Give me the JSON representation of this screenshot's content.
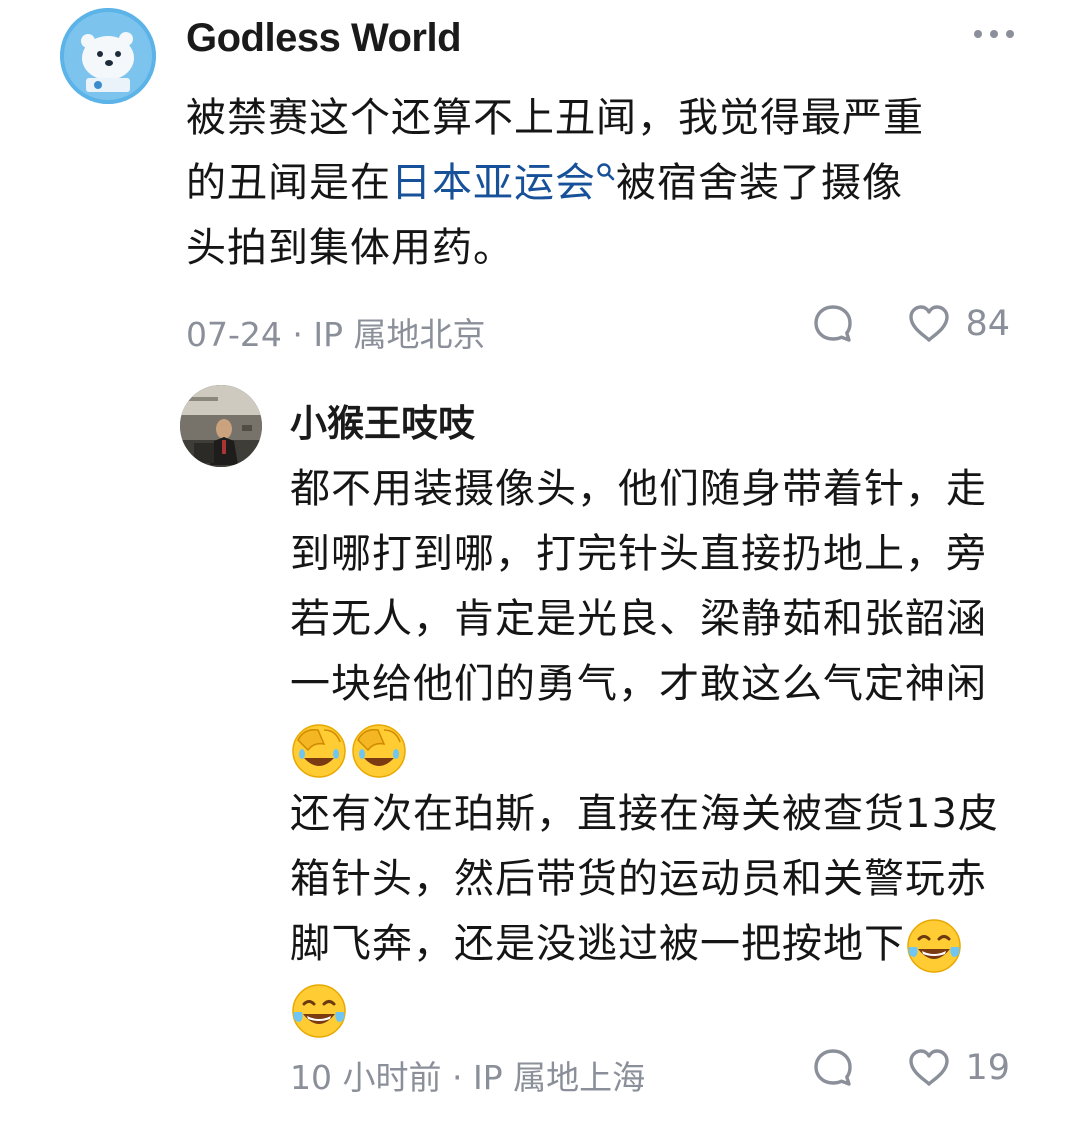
{
  "comments": [
    {
      "author": "Godless World",
      "avatar_icon": "polar-bear-avatar",
      "text_lines": [
        {
          "pre": "被禁赛这个还算不上丑闻，我觉得最严重"
        },
        {
          "pre": "的丑闻是在",
          "link": "日本亚运会",
          "post": "被宿舍装了摄像"
        },
        {
          "pre": "头拍到集体用药。"
        }
      ],
      "link_icon": "search-icon",
      "date": "07-24",
      "ip_location": "IP 属地北京",
      "like_count": "84",
      "more_icon": "more-dots-icon"
    },
    {
      "author": "小猴王吱吱",
      "avatar_icon": "speaker-photo-avatar",
      "text_lines": [
        "都不用装摄像头，他们随身带着针，走",
        "到哪打到哪，打完针头直接扔地上，旁",
        "若无人，肯定是光良、梁静茹和张韶涵",
        "一块给他们的勇气，才敢这么气定神闲",
        "",
        "还有次在珀斯，直接在海关被查货13皮",
        "箱针头，然后带货的运动员和关警玩赤",
        "脚飞奔，还是没逃过被一把按地下",
        ""
      ],
      "emoji_line_1": [
        "facepalm-laugh-emoji",
        "facepalm-laugh-emoji"
      ],
      "emoji_inline": "tears-of-joy-emoji",
      "emoji_line_2": [
        "tears-of-joy-emoji"
      ],
      "date": "10 小时前",
      "ip_location": "IP 属地上海",
      "like_count": "19"
    }
  ],
  "meta_separator": " · ",
  "icons": {
    "reply": "comment-bubble-icon",
    "like": "heart-icon"
  },
  "colors": {
    "link": "#175199",
    "meta": "#8a8f99",
    "text": "#151515"
  }
}
